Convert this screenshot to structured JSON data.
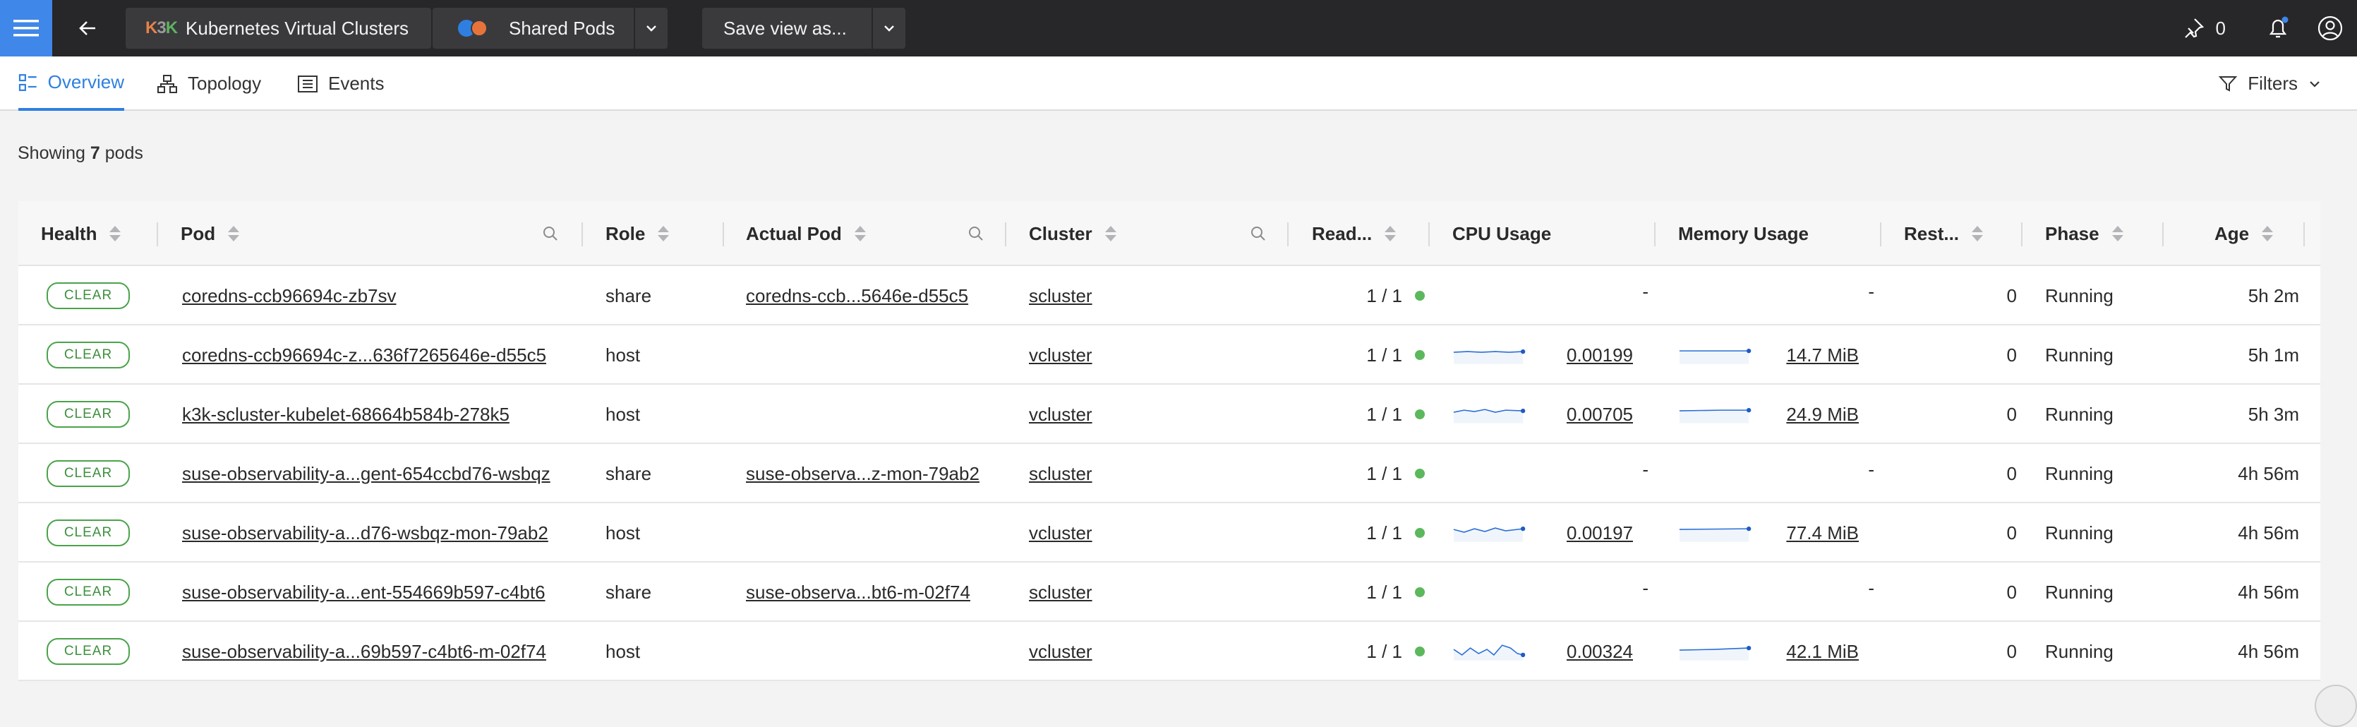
{
  "topbar": {
    "breadcrumb_1": "Kubernetes Virtual Clusters",
    "breadcrumb_1_logo": "K3K",
    "breadcrumb_2": "Shared Pods",
    "save_view": "Save view as...",
    "pin_count": "0"
  },
  "tabs": [
    {
      "label": "Overview"
    },
    {
      "label": "Topology"
    },
    {
      "label": "Events"
    }
  ],
  "filters_label": "Filters",
  "showing": {
    "prefix": "Showing",
    "count": "7",
    "suffix": "pods"
  },
  "columns": [
    "Health",
    "Pod",
    "Role",
    "Actual Pod",
    "Cluster",
    "Read...",
    "CPU Usage",
    "Memory Usage",
    "Rest...",
    "Phase",
    "Age"
  ],
  "rows": [
    {
      "health": "CLEAR",
      "pod": "coredns-ccb96694c-zb7sv",
      "role": "share",
      "actual_pod": "coredns-ccb...5646e-d55c5",
      "cluster": "scluster",
      "ready": "1 / 1",
      "cpu": "-",
      "memory": "-",
      "restarts": "0",
      "phase": "Running",
      "age": "5h 2m"
    },
    {
      "health": "CLEAR",
      "pod": "coredns-ccb96694c-z...636f7265646e-d55c5",
      "role": "host",
      "actual_pod": "",
      "cluster": "vcluster",
      "ready": "1 / 1",
      "cpu": "0.00199",
      "memory": "14.7 MiB",
      "restarts": "0",
      "phase": "Running",
      "age": "5h 1m"
    },
    {
      "health": "CLEAR",
      "pod": "k3k-scluster-kubelet-68664b584b-278k5",
      "role": "host",
      "actual_pod": "",
      "cluster": "vcluster",
      "ready": "1 / 1",
      "cpu": "0.00705",
      "memory": "24.9 MiB",
      "restarts": "0",
      "phase": "Running",
      "age": "5h 3m"
    },
    {
      "health": "CLEAR",
      "pod": "suse-observability-a...gent-654ccbd76-wsbqz",
      "role": "share",
      "actual_pod": "suse-observa...z-mon-79ab2",
      "cluster": "scluster",
      "ready": "1 / 1",
      "cpu": "-",
      "memory": "-",
      "restarts": "0",
      "phase": "Running",
      "age": "4h 56m"
    },
    {
      "health": "CLEAR",
      "pod": "suse-observability-a...d76-wsbqz-mon-79ab2",
      "role": "host",
      "actual_pod": "",
      "cluster": "vcluster",
      "ready": "1 / 1",
      "cpu": "0.00197",
      "memory": "77.4 MiB",
      "restarts": "0",
      "phase": "Running",
      "age": "4h 56m"
    },
    {
      "health": "CLEAR",
      "pod": "suse-observability-a...ent-554669b597-c4bt6",
      "role": "share",
      "actual_pod": "suse-observa...bt6-m-02f74",
      "cluster": "scluster",
      "ready": "1 / 1",
      "cpu": "-",
      "memory": "-",
      "restarts": "0",
      "phase": "Running",
      "age": "4h 56m"
    },
    {
      "health": "CLEAR",
      "pod": "suse-observability-a...69b597-c4bt6-m-02f74",
      "role": "host",
      "actual_pod": "",
      "cluster": "vcluster",
      "ready": "1 / 1",
      "cpu": "0.00324",
      "memory": "42.1 MiB",
      "restarts": "0",
      "phase": "Running",
      "age": "4h 56m"
    }
  ],
  "colors": {
    "accent": "#2f7fe0",
    "topbar": "#272729",
    "clear": "#4aa34a",
    "ready_dot": "#5cb85c",
    "sparkline": "#2a6fd6"
  },
  "icons": [
    "menu-icon",
    "back-arrow-icon",
    "pin-icon",
    "bell-icon",
    "user-icon",
    "filter-icon",
    "search-icon",
    "sort-icon",
    "overview-icon",
    "topology-icon",
    "events-icon",
    "chevron-down-icon"
  ]
}
